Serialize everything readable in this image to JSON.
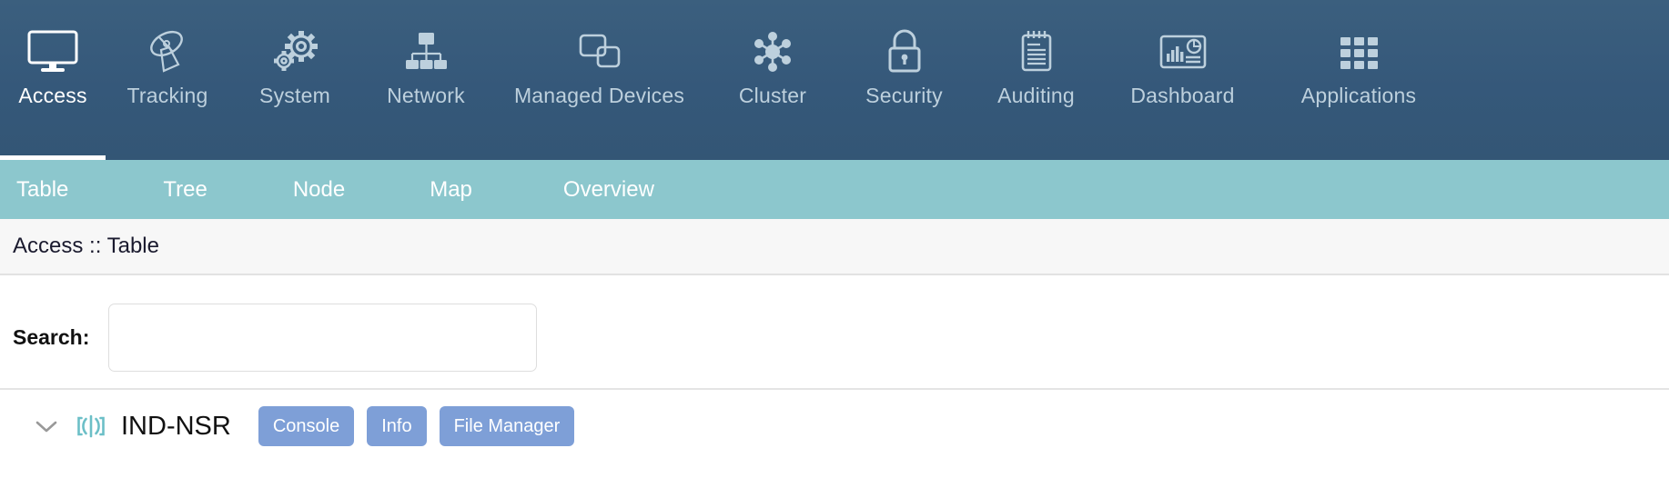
{
  "primary_nav": {
    "active": "Access",
    "items": [
      {
        "label": "Access",
        "icon": "monitor-icon"
      },
      {
        "label": "Tracking",
        "icon": "satellite-dish-icon"
      },
      {
        "label": "System",
        "icon": "gears-icon"
      },
      {
        "label": "Network",
        "icon": "network-tree-icon"
      },
      {
        "label": "Managed Devices",
        "icon": "windows-stack-icon"
      },
      {
        "label": "Cluster",
        "icon": "cluster-nodes-icon"
      },
      {
        "label": "Security",
        "icon": "padlock-icon"
      },
      {
        "label": "Auditing",
        "icon": "notepad-icon"
      },
      {
        "label": "Dashboard",
        "icon": "dashboard-chart-icon"
      },
      {
        "label": "Applications",
        "icon": "grid-apps-icon"
      }
    ]
  },
  "secondary_nav": {
    "active": "Table",
    "tabs": [
      {
        "label": "Table"
      },
      {
        "label": "Tree"
      },
      {
        "label": "Node"
      },
      {
        "label": "Map"
      },
      {
        "label": "Overview"
      }
    ]
  },
  "breadcrumb": {
    "text": "Access :: Table"
  },
  "search": {
    "label": "Search:",
    "value": "",
    "placeholder": ""
  },
  "device_list": {
    "rows": [
      {
        "expand_icon": "chevron-down-icon",
        "status_icon": "broadcast-signal-icon",
        "name": "IND-NSR",
        "actions": [
          {
            "label": "Console"
          },
          {
            "label": "Info"
          },
          {
            "label": "File Manager"
          }
        ]
      }
    ]
  },
  "colors": {
    "nav_background": "#35587a",
    "nav_label": "#bdd0dd",
    "nav_label_active": "#ffffff",
    "subnav_background": "#8cc7cd",
    "breadcrumb_background": "#f7f7f7",
    "button_blue": "#7e9fd7",
    "device_icon_teal": "#6cbfc7"
  }
}
